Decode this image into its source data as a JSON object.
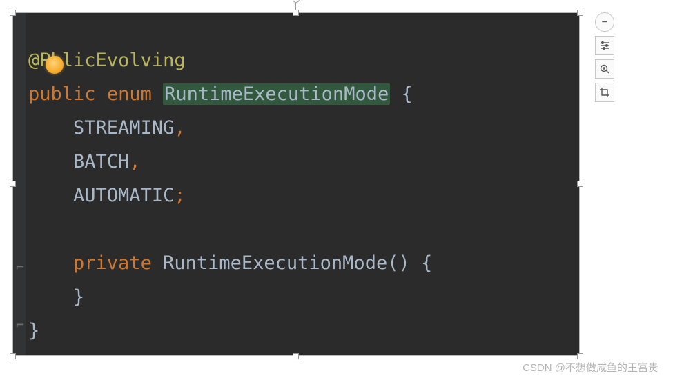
{
  "code": {
    "annotation_at": "@",
    "annotation_name_pre": "P",
    "annotation_name_post": "blicEvolving",
    "kw_public": "public",
    "kw_enum": "enum",
    "class_name": "RuntimeExecutionMode",
    "brace_open": "{",
    "enum1": "STREAMING",
    "comma": ",",
    "enum2": "BATCH",
    "enum3": "AUTOMATIC",
    "semicolon": ";",
    "kw_private": "private",
    "ctor_name": "RuntimeExecutionMode",
    "paren": "()",
    "brace_close": "}",
    "fold_top": "⌐",
    "fold_bottom": "⌐"
  },
  "toolbar": {
    "minus": "−"
  },
  "watermark": "CSDN @不想做咸鱼的王富贵"
}
